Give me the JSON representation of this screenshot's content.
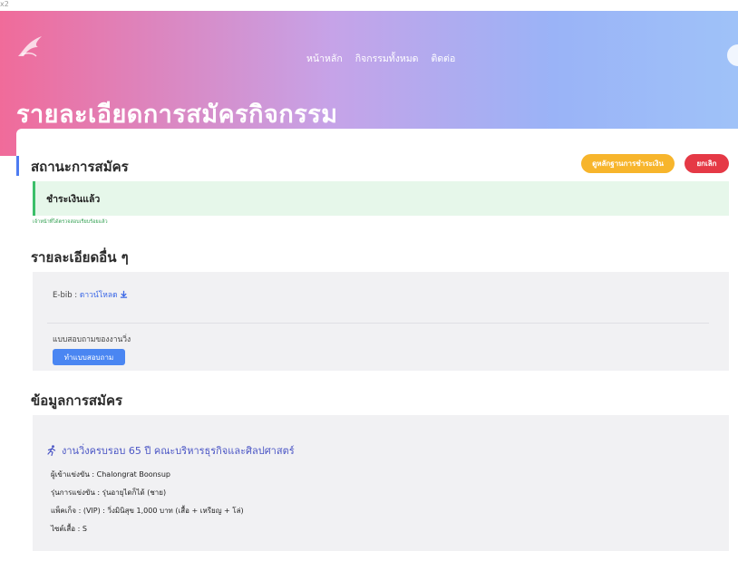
{
  "corner_mark": "x2",
  "nav": {
    "items": [
      "หน้าหลัก",
      "กิจกรรมทั้งหมด",
      "ติดต่อ"
    ]
  },
  "hero": {
    "title": "รายละเอียดการสมัครกิจกรรม"
  },
  "status": {
    "heading": "สถานะการสมัคร",
    "view_receipt_label": "ดูหลักฐานการชำระเงิน",
    "cancel_label": "ยกเลิก",
    "paid_text": "ชำระเงินแล้ว",
    "paid_note": "เจ้าหน้าที่ได้ตรวจสอบเรียบร้อยแล้ว"
  },
  "other": {
    "heading": "รายละเอียดอื่น ๆ",
    "ebib_label": "E-bib :",
    "ebib_link": "ดาวน์โหลด",
    "survey_label": "แบบสอบถามของงานวิ่ง",
    "survey_button": "ทำแบบสอบถาม"
  },
  "registration": {
    "heading": "ข้อมูลการสมัคร",
    "event_title": "งานวิ่งครบรอบ 65 ปี คณะบริหารธุรกิจและศิลปศาสตร์",
    "lines": [
      "ผู้เข้าแข่งขัน : Chalongrat Boonsup",
      "รุ่นการแข่งขัน : รุ่นอายุไดก็ได้ (ชาย)",
      "แพ็คเก็จ : (VIP) : วิ่งมินิสุข 1,000 บาท (เสื้อ + เหรียญ + โล่)",
      "ไซต์เสื้อ : S"
    ]
  },
  "colors": {
    "accent": "#4e7cf2",
    "receipt_button": "#f7b52c",
    "cancel_button": "#e53946",
    "paid_bg": "#e6f7ea",
    "paid_border": "#3cbf6a"
  },
  "icons": {
    "logo": "bird-logo-icon",
    "download": "download-icon",
    "runner": "runner-icon"
  }
}
